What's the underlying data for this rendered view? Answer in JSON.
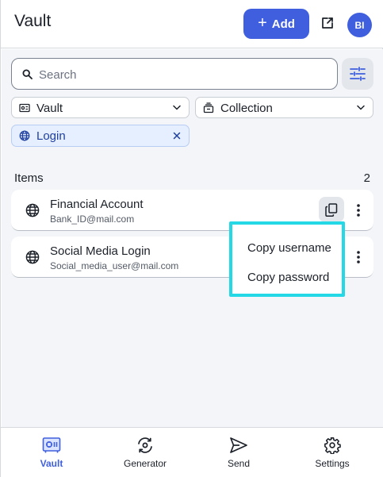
{
  "header": {
    "title": "Vault",
    "add_label": "Add",
    "avatar_initials": "BI"
  },
  "search": {
    "placeholder": "Search",
    "value": ""
  },
  "filters": {
    "vault_select": "Vault",
    "collection_select": "Collection",
    "active_chip": "Login"
  },
  "items_section": {
    "heading": "Items",
    "count": "2",
    "items": [
      {
        "name": "Financial Account",
        "subtitle": "Bank_ID@mail.com",
        "icon": "globe-icon"
      },
      {
        "name": "Social Media Login",
        "subtitle": "Social_media_user@mail.com",
        "icon": "globe-icon"
      }
    ]
  },
  "copy_menu": {
    "items": [
      "Copy username",
      "Copy password"
    ],
    "highlight_color": "#25d8e6"
  },
  "bottom_nav": {
    "items": [
      {
        "label": "Vault",
        "icon": "vault-icon",
        "active": true
      },
      {
        "label": "Generator",
        "icon": "generator-icon",
        "active": false
      },
      {
        "label": "Send",
        "icon": "send-icon",
        "active": false
      },
      {
        "label": "Settings",
        "icon": "gear-icon",
        "active": false
      }
    ]
  },
  "colors": {
    "accent": "#3f5fde",
    "chip_bg": "#e5efff"
  }
}
